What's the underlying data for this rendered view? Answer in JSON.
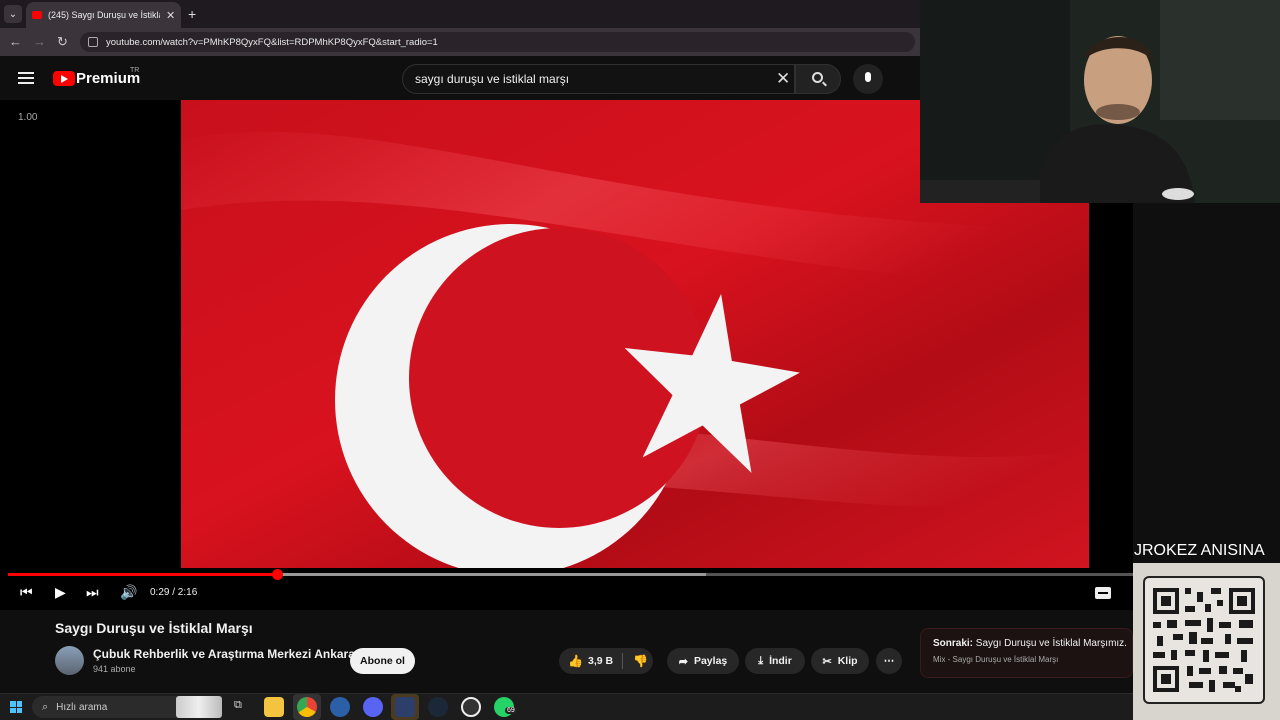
{
  "browser": {
    "tab_title": "(245) Saygı Duruşu ve İstiklal M",
    "tab_close": "✕",
    "new_tab": "+",
    "url": "youtube.com/watch?v=PMhKP8QyxFQ&list=RDPMhKP8QyxFQ&start_radio=1",
    "nav": {
      "back": "←",
      "forward": "→",
      "reload": "↻"
    }
  },
  "youtube_header": {
    "brand": "Premium",
    "region": "TR",
    "search_query": "saygı duruşu ve istiklal marşı",
    "clear": "✕"
  },
  "player": {
    "speed_label": "1.00",
    "time": "0:29 / 2:16",
    "progress": 0.24,
    "buffered": 0.62,
    "controls": {
      "prev": "⏮",
      "play": "▶",
      "next": "⏭",
      "volume": "🔊"
    }
  },
  "video": {
    "title": "Saygı Duruşu ve İstiklal Marşı",
    "channel": "Çubuk Rehberlik ve Araştırma Merkezi Ankara",
    "subscribers": "941 abone",
    "subscribe_label": "Abone ol",
    "likes": "3,9 B",
    "share_label": "Paylaş",
    "download_label": "İndir",
    "clip_label": "Klip",
    "more": "⋯"
  },
  "up_next": {
    "prefix": "Sonraki:",
    "title": "Saygı Duruşu ve İstiklal Marşımız.",
    "subtitle": "Mix - Saygı Duruşu ve İstiklal Marşı"
  },
  "stream_overlay": {
    "text": "JROKEZ ANISINA"
  },
  "taskbar": {
    "search_placeholder": "Hızlı arama",
    "whatsapp_badge": "69"
  },
  "colors": {
    "accent": "#ff0000",
    "background": "#0f0f0f"
  }
}
